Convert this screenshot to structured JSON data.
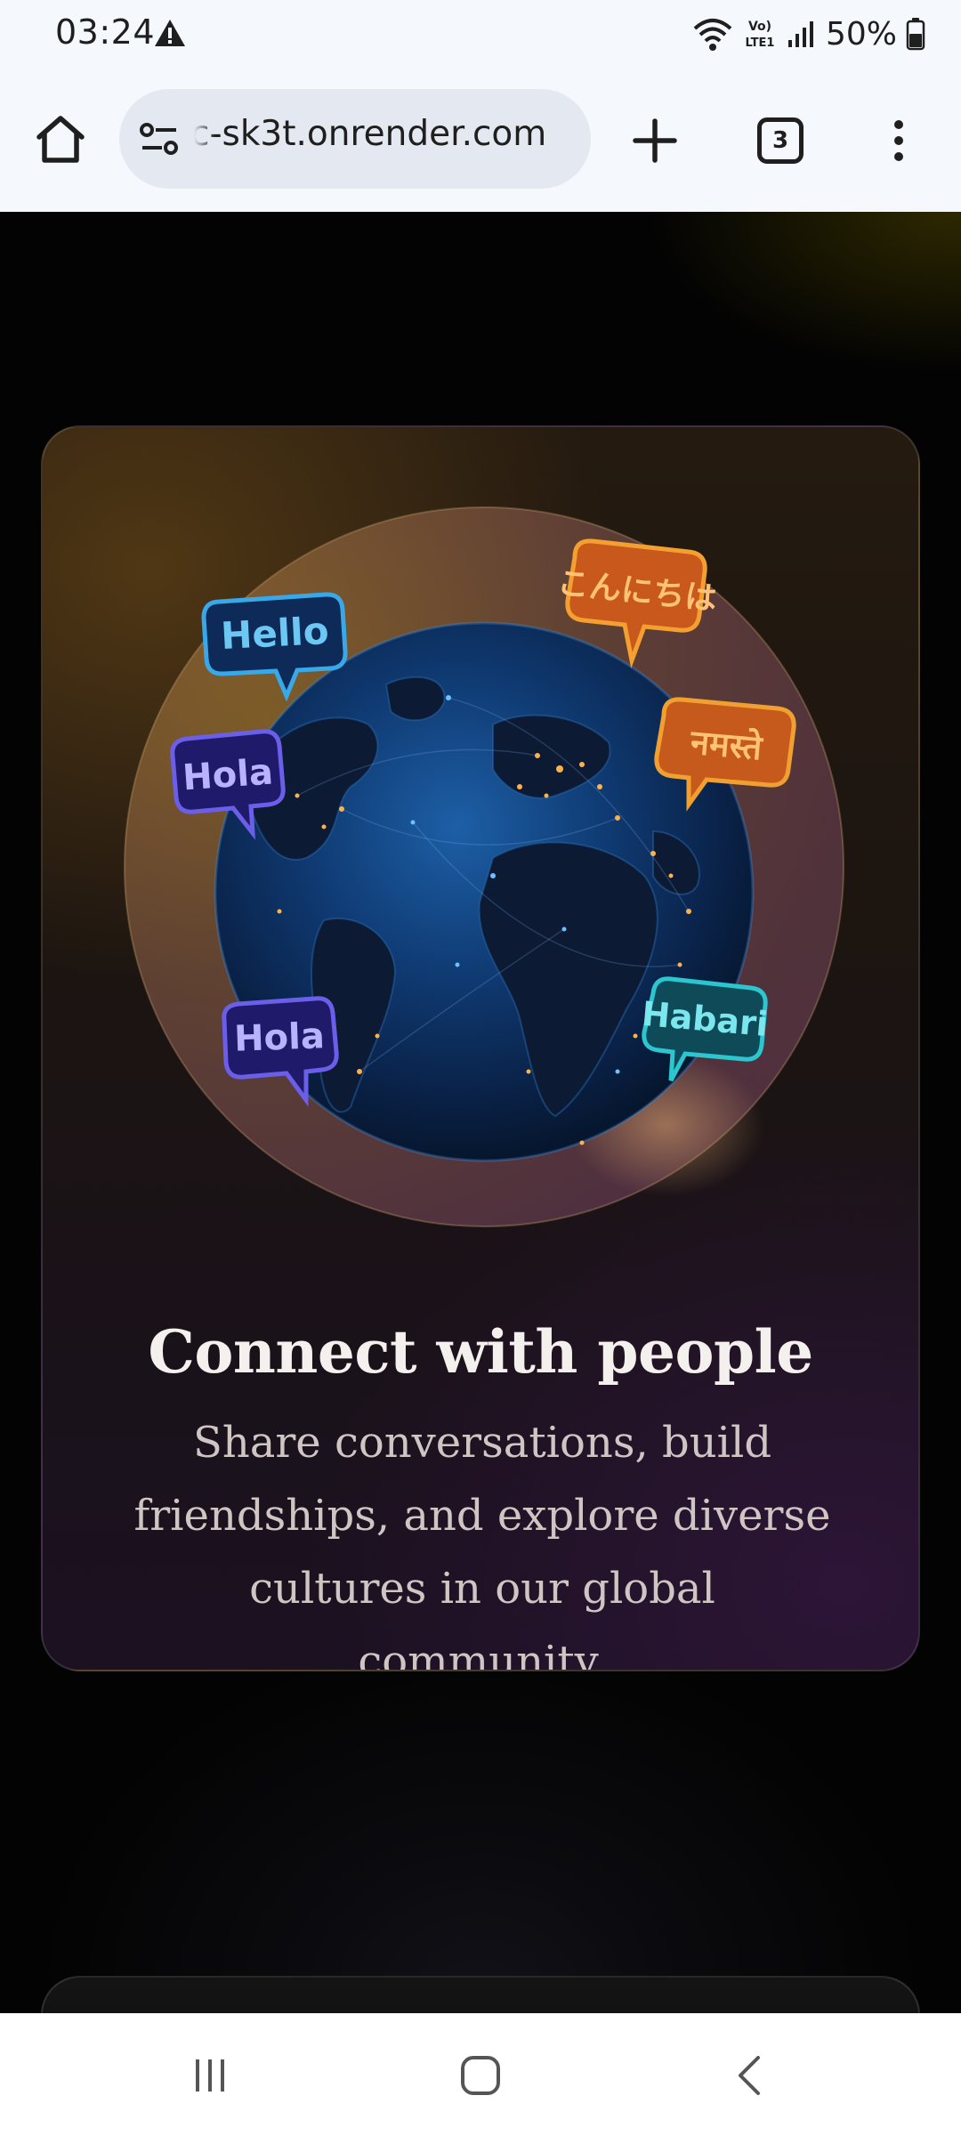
{
  "status_bar": {
    "time": "03:24",
    "battery": "50%",
    "network_label": "Vo) LTE1"
  },
  "browser": {
    "url": "c-sk3t.onrender.com",
    "tab_count": "3",
    "icons": [
      "home-icon",
      "site-settings-icon",
      "plus-icon",
      "tab-switcher-icon",
      "more-vert-icon"
    ]
  },
  "card": {
    "title": "Connect with people",
    "description": "Share conversations, build friendships, and explore diverse cultures in our global community.",
    "bubbles": [
      {
        "text": "Hello",
        "color": "#39a8e8"
      },
      {
        "text": "こんにちは",
        "color": "#f08a28"
      },
      {
        "text": "नमस्ते",
        "color": "#f08a28"
      },
      {
        "text": "Hola",
        "color": "#6b5ee8"
      },
      {
        "text": "Hola",
        "color": "#6b5ee8"
      },
      {
        "text": "Habari",
        "color": "#2cc6cf"
      }
    ]
  },
  "colors": {
    "background": "#030303",
    "text_primary": "#f3f0ee",
    "text_secondary": "#cfc6c4",
    "toolbar": "#f5f8fc"
  },
  "nav_bar": {
    "icons": [
      "recent-apps-icon",
      "home-nav-icon",
      "back-icon"
    ]
  }
}
